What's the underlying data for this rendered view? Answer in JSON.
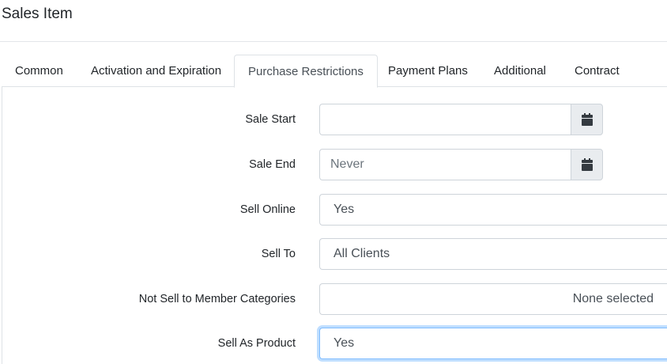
{
  "page": {
    "title": "Sales Item"
  },
  "tabs": [
    {
      "label": "Common"
    },
    {
      "label": "Activation and Expiration"
    },
    {
      "label": "Purchase Restrictions",
      "active": true
    },
    {
      "label": "Payment Plans"
    },
    {
      "label": "Additional"
    },
    {
      "label": "Contract"
    }
  ],
  "form": {
    "sale_start": {
      "label": "Sale Start",
      "value": "",
      "icon": "calendar-icon"
    },
    "sale_end": {
      "label": "Sale End",
      "placeholder": "Never",
      "icon": "calendar-icon"
    },
    "sell_online": {
      "label": "Sell Online",
      "value": "Yes"
    },
    "sell_to": {
      "label": "Sell To",
      "value": "All Clients"
    },
    "not_sell_to_member_categories": {
      "label": "Not Sell to Member Categories",
      "value": "None selected"
    },
    "sell_as_product": {
      "label": "Sell As Product",
      "value": "Yes"
    }
  }
}
